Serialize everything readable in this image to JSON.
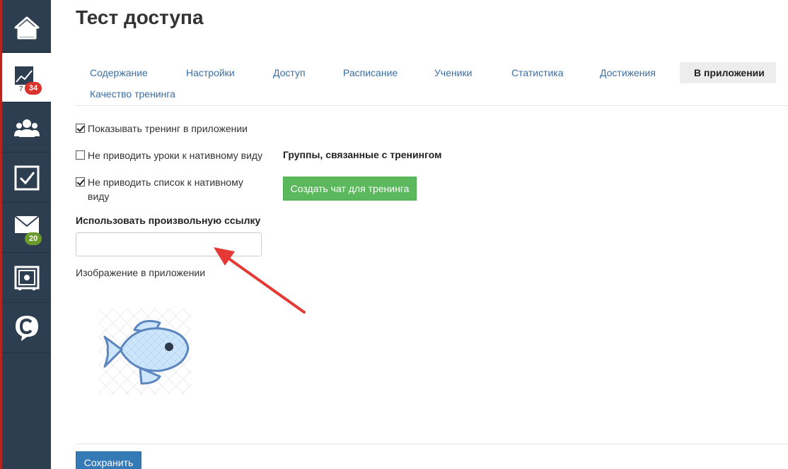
{
  "page": {
    "title": "Тест доступа"
  },
  "sidebar": {
    "items": [
      {
        "icon": "home-icon"
      },
      {
        "icon": "chart-icon",
        "badge": "34",
        "sub": "7"
      },
      {
        "icon": "users-icon"
      },
      {
        "icon": "checkbox-icon"
      },
      {
        "icon": "mail-icon",
        "badge": "20"
      },
      {
        "icon": "safe-icon"
      },
      {
        "icon": "chat-c-icon"
      }
    ]
  },
  "tabs": [
    {
      "label": "Содержание"
    },
    {
      "label": "Настройки"
    },
    {
      "label": "Доступ"
    },
    {
      "label": "Расписание"
    },
    {
      "label": "Ученики"
    },
    {
      "label": "Статистика"
    },
    {
      "label": "Достижения"
    },
    {
      "label": "В приложении",
      "active": true
    },
    {
      "label": "Качество тренинга"
    }
  ],
  "form": {
    "show_in_app": {
      "label": "Показывать тренинг в приложении",
      "checked": true
    },
    "no_native_lessons": {
      "label": "Не приводить уроки к нативному виду",
      "checked": false
    },
    "no_native_list": {
      "label": "Не приводить список к нативному виду",
      "checked": true
    },
    "custom_link": {
      "label": "Использовать произвольную ссылку",
      "value": ""
    },
    "image_label": "Изображение в приложении",
    "groups_label": "Группы, связанные с тренингом",
    "create_chat_button": "Создать чат для тренинга",
    "save_button": "Сохранить"
  },
  "colors": {
    "sidebar": "#2c3e50",
    "accent_link": "#3a6ea5",
    "green_button": "#5cb85c",
    "save_button": "#337ab7",
    "arrow": "#e53935"
  }
}
